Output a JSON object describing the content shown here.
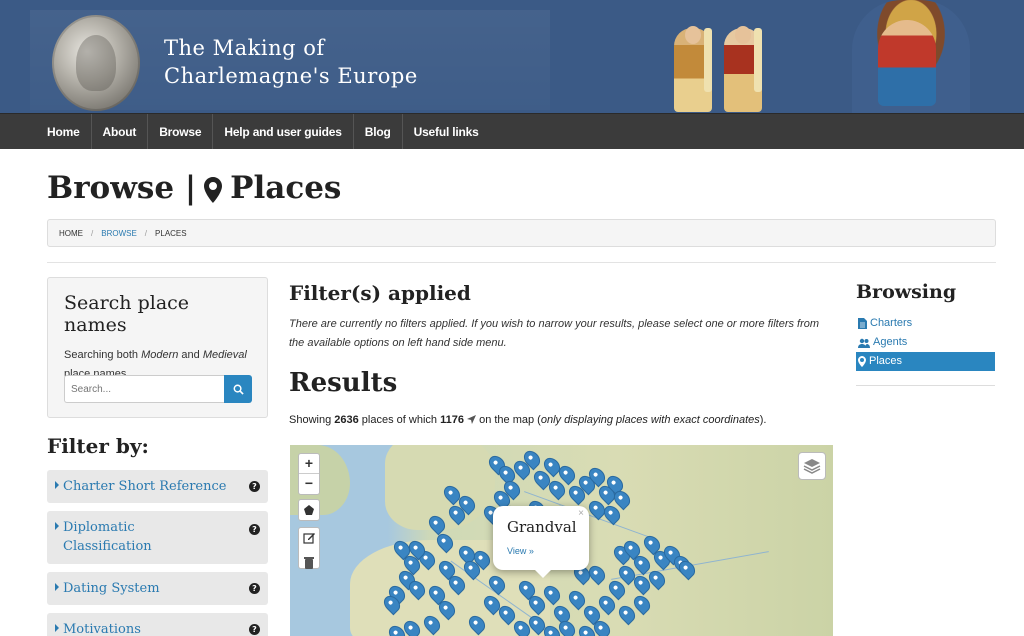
{
  "header": {
    "title_line1": "The Making of",
    "title_line2": "Charlemagne's Europe"
  },
  "nav": {
    "items": [
      "Home",
      "About",
      "Browse",
      "Help and user guides",
      "Blog",
      "Useful links"
    ]
  },
  "page": {
    "title_prefix": "Browse |",
    "title_main": "Places"
  },
  "breadcrumb": {
    "home": "HOME",
    "browse": "BROWSE",
    "current": "PLACES",
    "separator": "/"
  },
  "search": {
    "title": "Search place names",
    "desc_pre": "Searching both ",
    "desc_modern": "Modern",
    "desc_and": " and ",
    "desc_medieval": "Medieval",
    "desc_post": " place names.",
    "placeholder": "Search..."
  },
  "filters": {
    "title": "Filter by:",
    "items": [
      "Charter Short Reference",
      "Diplomatic Classification",
      "Dating System",
      "Motivations"
    ],
    "help_glyph": "?"
  },
  "main": {
    "filters_title": "Filter(s) applied",
    "filters_text": "There are currently no filters applied. If you wish to narrow your results, please select one or more filters from the available options on left hand side menu.",
    "results_title": "Results",
    "showing_pre": "Showing ",
    "total": "2636",
    "showing_mid": " places of which ",
    "mapped": "1176",
    "showing_post": " on the map (",
    "showing_italic": "only displaying places with exact coordinates",
    "showing_end": ")."
  },
  "map": {
    "zoom_in": "+",
    "zoom_out": "−",
    "popup_name": "Grandval",
    "popup_link": "View »",
    "popup_close": "×",
    "marker_color": "#3a85c2"
  },
  "sidebar": {
    "title": "Browsing",
    "links": [
      {
        "label": "Charters",
        "icon": "document-icon",
        "active": false
      },
      {
        "label": "Agents",
        "icon": "users-icon",
        "active": false
      },
      {
        "label": "Places",
        "icon": "map-pin-icon",
        "active": true
      }
    ]
  },
  "colors": {
    "header_bg": "#3b5a86",
    "nav_bg": "#3b3b3b",
    "link": "#2a7ab0",
    "accent": "#2a86c0"
  }
}
